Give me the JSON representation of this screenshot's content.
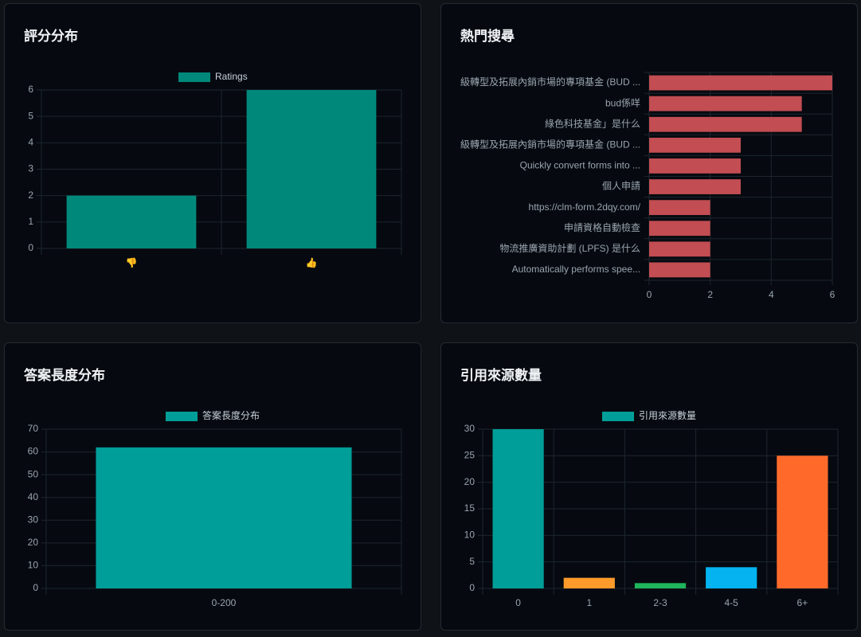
{
  "colors": {
    "ratings": "#00897b",
    "top_search": "#c24d52",
    "answer_length": "#009e98",
    "citations": [
      "#009e98",
      "#ff9a2b",
      "#1fb55c",
      "#04b3f0",
      "#ff6a2b"
    ],
    "grid": "#1e252e",
    "tick": "#9aa4ae"
  },
  "panels": [
    {
      "title": "評分分布",
      "chart_data": {
        "type": "bar",
        "categories": [
          "👎",
          "👍"
        ],
        "series": [
          {
            "name": "Ratings",
            "values": [
              2,
              6
            ]
          }
        ],
        "ylim": [
          0,
          6
        ],
        "yticks": [
          0,
          1,
          2,
          3,
          4,
          5,
          6
        ],
        "legend": "top-center",
        "grid": true
      }
    },
    {
      "title": "熱門搜尋",
      "chart_data": {
        "type": "bar",
        "orientation": "horizontal",
        "categories": [
          "級轉型及拓展內銷市場的專項基金 (BUD ...",
          "bud係咩",
          "綠色科技基金」是什么",
          "級轉型及拓展內銷市場的專項基金 (BUD ...",
          "Quickly convert forms into ...",
          "個人申請",
          "https://clm-form.2dqy.com/",
          "申請資格自動檢查",
          "物流推廣資助計劃 (LPFS) 是什么",
          "Automatically performs spee..."
        ],
        "values": [
          6,
          5,
          5,
          3,
          3,
          3,
          2,
          2,
          2,
          2
        ],
        "xlim": [
          0,
          6
        ],
        "xticks": [
          0,
          2,
          4,
          6
        ],
        "grid": true
      }
    },
    {
      "title": "答案長度分布",
      "chart_data": {
        "type": "bar",
        "categories": [
          "0-200"
        ],
        "series": [
          {
            "name": "答案長度分布",
            "values": [
              62
            ]
          }
        ],
        "ylim": [
          0,
          70
        ],
        "yticks": [
          0,
          10,
          20,
          30,
          40,
          50,
          60,
          70
        ],
        "legend": "top-center",
        "grid": true
      }
    },
    {
      "title": "引用來源數量",
      "chart_data": {
        "type": "bar",
        "categories": [
          "0",
          "1",
          "2-3",
          "4-5",
          "6+"
        ],
        "series": [
          {
            "name": "引用來源數量",
            "values": [
              30,
              2,
              1,
              4,
              25
            ]
          }
        ],
        "ylim": [
          0,
          30
        ],
        "yticks": [
          0,
          5,
          10,
          15,
          20,
          25,
          30
        ],
        "legend": "top-center",
        "grid": true
      }
    }
  ]
}
